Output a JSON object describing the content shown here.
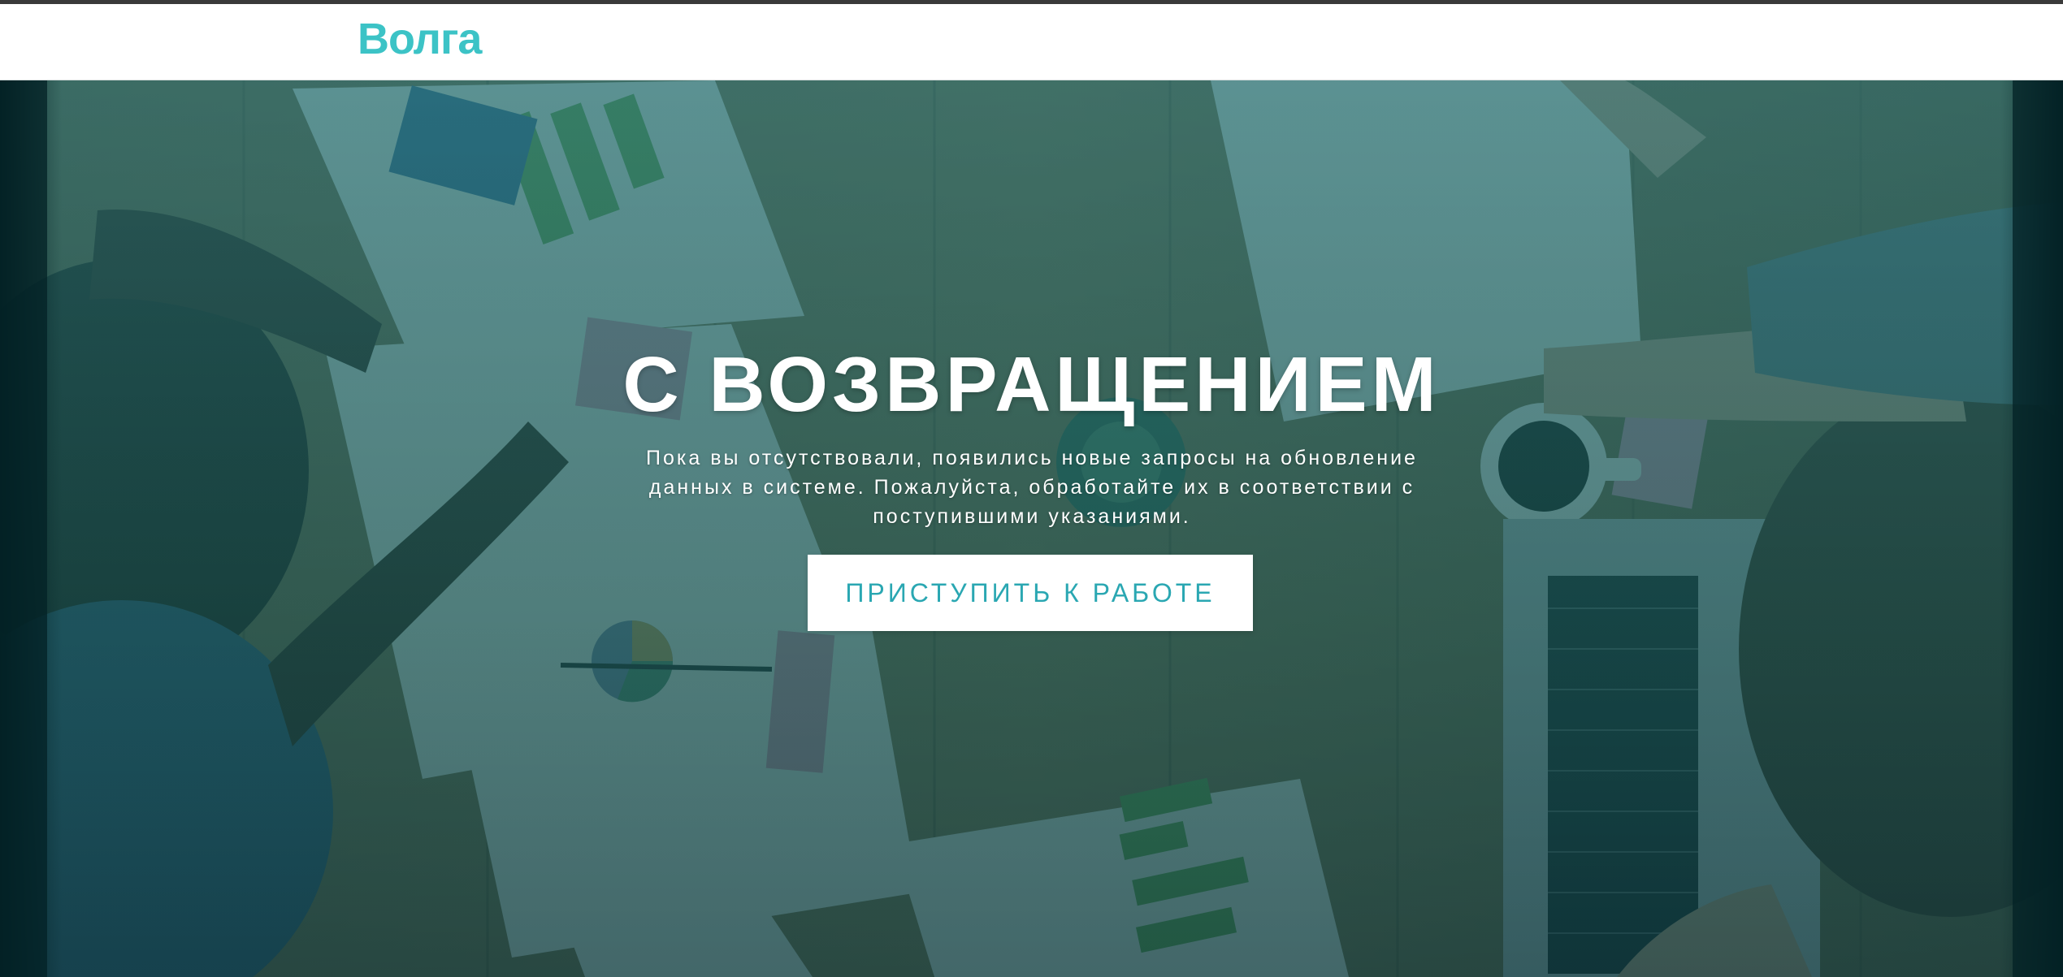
{
  "header": {
    "logo_text": "Волга"
  },
  "hero": {
    "title": "С ВОЗВРАЩЕНИЕМ",
    "message": "Пока вы отсутствовали, появились новые запросы на обновление данных в системе. Пожалуйста, обработайте их в соответствии с поступившими указаниями.",
    "button_label": "ПРИСТУПИТЬ К РАБОТЕ",
    "background_image": "office-desk-meeting-photo"
  },
  "colors": {
    "brand": "#3cc3c6",
    "button_text": "#2aa7b2",
    "overlay": "#0f6e74"
  }
}
